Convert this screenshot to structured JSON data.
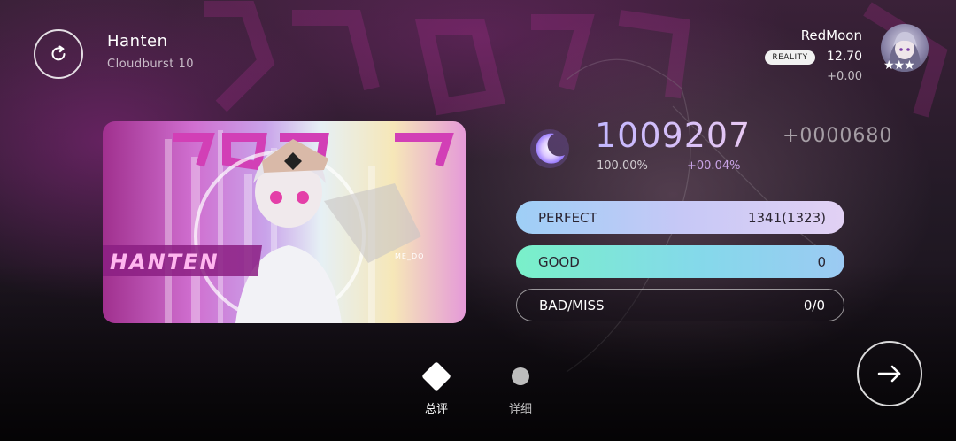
{
  "song": {
    "title": "Hanten",
    "difficulty": "Cloudburst 10"
  },
  "player": {
    "name": "RedMoon",
    "badge": "REALITY",
    "rks": "12.70",
    "rks_delta": "+0.00",
    "stars": "★★★"
  },
  "cover_art": {
    "logo_text": "HANTEN",
    "artist_credit": "ME_DO"
  },
  "result": {
    "score": "1009207",
    "score_delta": "+0000680",
    "accuracy": "100.00%",
    "accuracy_delta": "+00.04%"
  },
  "judgements": [
    {
      "label": "PERFECT",
      "value": "1341(1323)"
    },
    {
      "label": "GOOD",
      "value": "0"
    },
    {
      "label": "BAD/MISS",
      "value": "0/0"
    }
  ],
  "tabs": [
    {
      "label": "总评",
      "selected": true
    },
    {
      "label": "详细",
      "selected": false
    }
  ],
  "icons": {
    "retry": "retry-icon",
    "next": "arrow-right-icon",
    "grade": "moon-icon"
  },
  "colors": {
    "perfect_bar": "#c6c8f6",
    "good_bar": "#84d9ea",
    "score_text": "#c2b6ff"
  }
}
